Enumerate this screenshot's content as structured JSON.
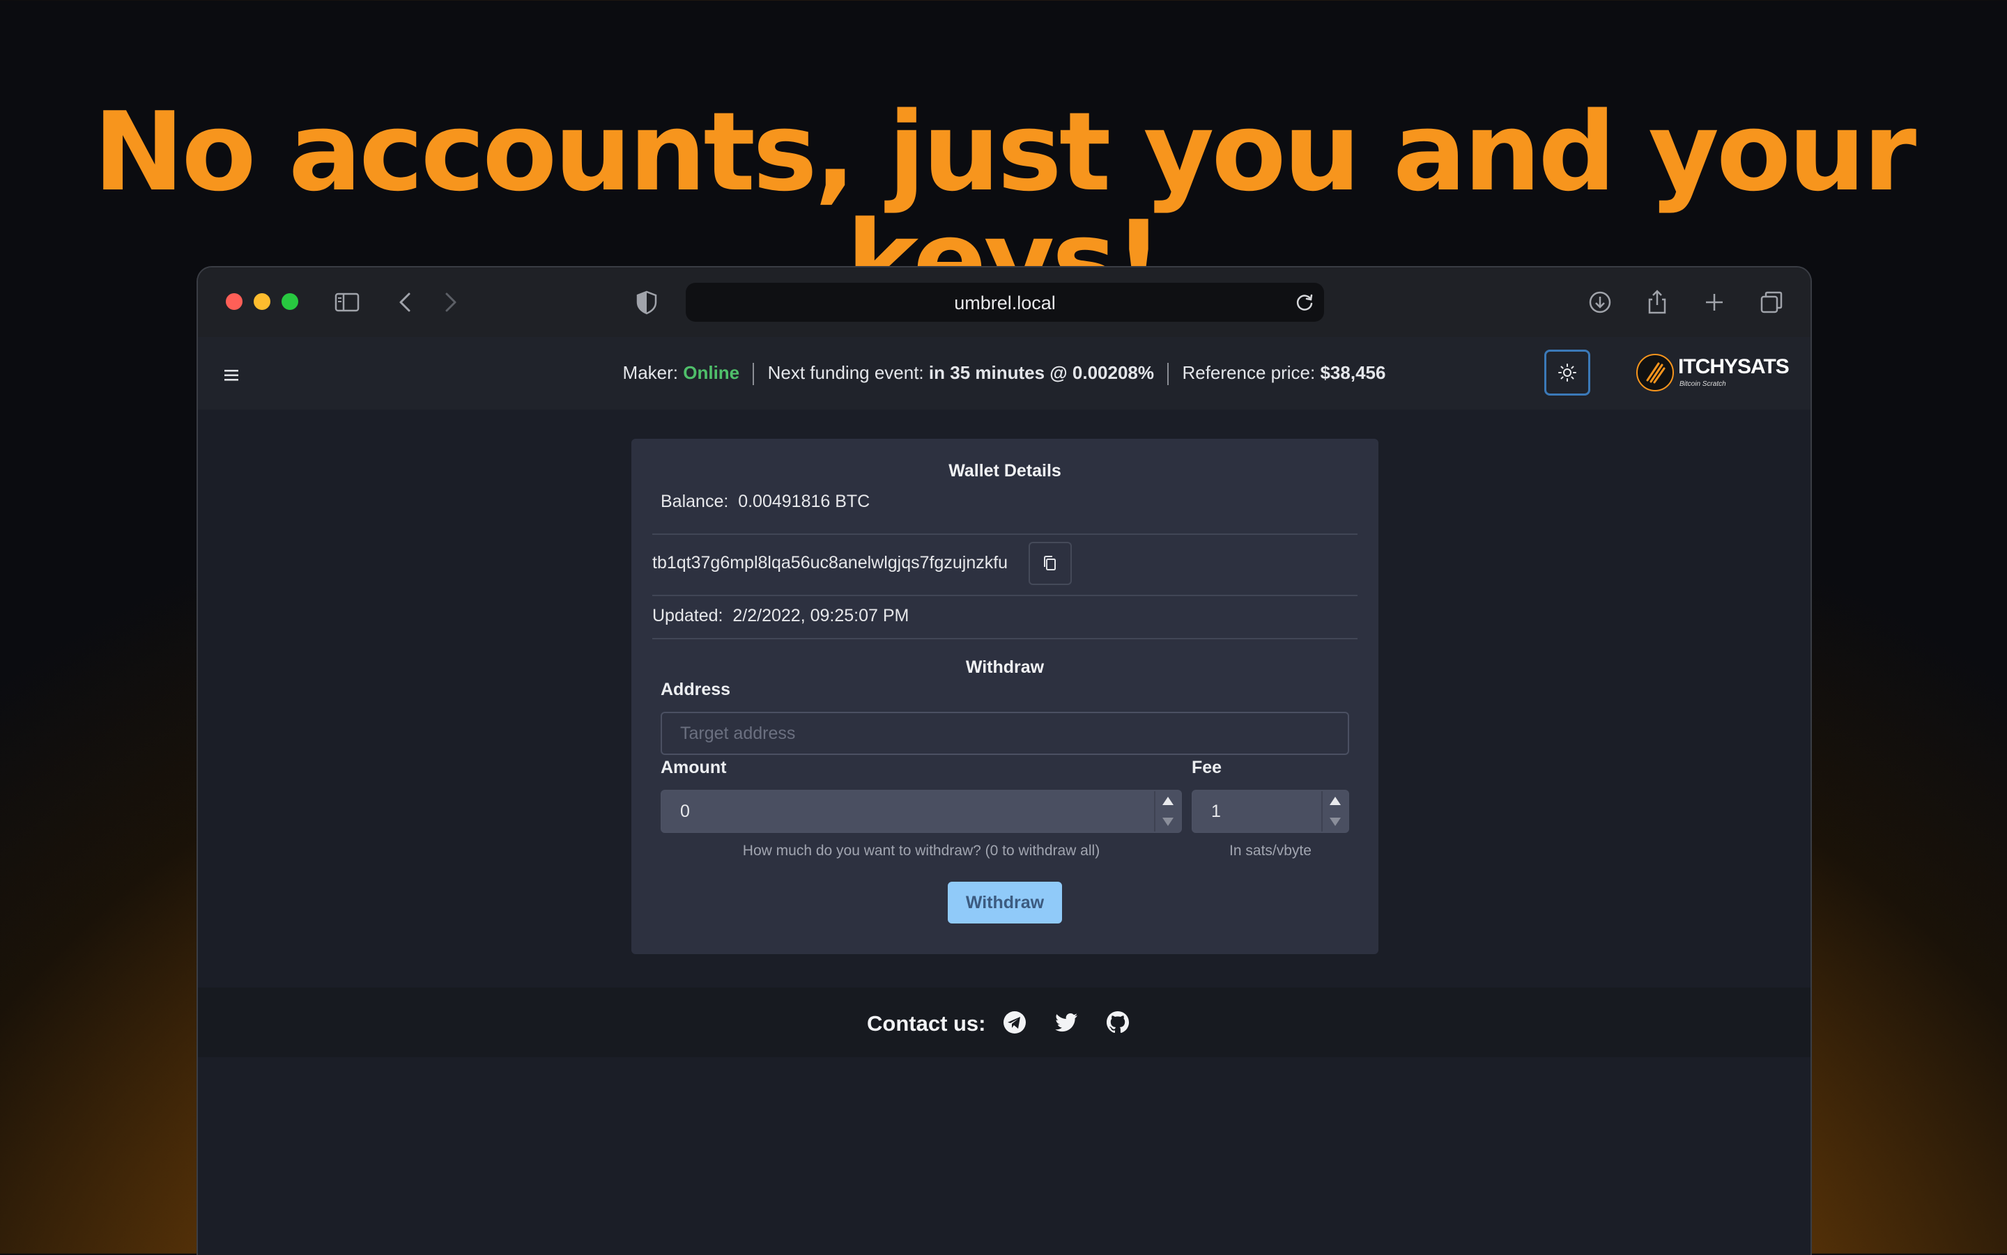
{
  "headline": "No accounts, just you and your keys!",
  "browser": {
    "url": "umbrel.local",
    "traffic_colors": [
      "#ff5f57",
      "#febc2e",
      "#28c840"
    ]
  },
  "appbar": {
    "maker_label": "Maker:",
    "maker_status": "Online",
    "funding_label": "Next funding event:",
    "funding_time": "in 35 minutes",
    "funding_at": "@",
    "funding_rate": "0.00208%",
    "reference_label": "Reference price:",
    "reference_price": "$38,456",
    "logo_name": "ITCHYSATS",
    "logo_tag": "Bitcoin Scratch"
  },
  "wallet": {
    "title": "Wallet Details",
    "balance_label": "Balance:",
    "balance_value": "0.00491816 BTC",
    "address": "tb1qt37g6mpl8lqa56uc8anelwlgjqs7fgzujnzkfu",
    "updated_label": "Updated:",
    "updated_value": "2/2/2022, 09:25:07 PM"
  },
  "withdraw": {
    "title": "Withdraw",
    "address_label": "Address",
    "address_placeholder": "Target address",
    "amount_label": "Amount",
    "amount_value": "0",
    "amount_help": "How much do you want to withdraw? (0 to withdraw all)",
    "fee_label": "Fee",
    "fee_value": "1",
    "fee_help": "In sats/vbyte",
    "button_label": "Withdraw"
  },
  "footer": {
    "contact_label": "Contact us:",
    "icons": [
      "telegram-icon",
      "twitter-icon",
      "github-icon"
    ]
  }
}
